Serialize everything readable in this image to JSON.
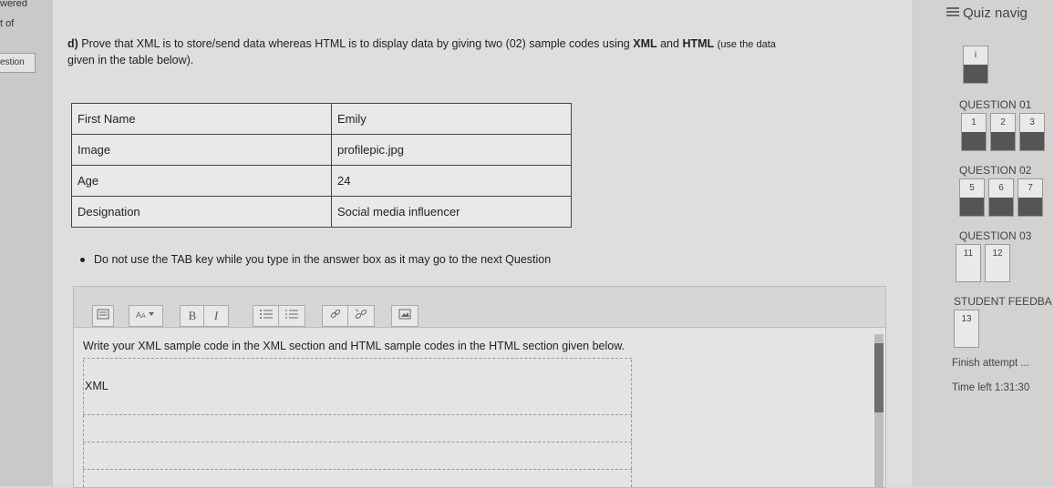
{
  "left_strip": {
    "answered": "wered",
    "of": "t of",
    "question": "estion"
  },
  "question": {
    "part": "d)",
    "text_main": "Prove that XML is to store/send data whereas HTML is to display data by giving two (02) sample codes using",
    "xml": "XML",
    "and": "and",
    "html": "HTML",
    "paren": "(use the data",
    "line2": "given in the table below)."
  },
  "table": [
    {
      "label": "First Name",
      "value": "Emily"
    },
    {
      "label": "Image",
      "value": "profilepic.jpg"
    },
    {
      "label": "Age",
      "value": "24"
    },
    {
      "label": "Designation",
      "value": "Social media influencer"
    }
  ],
  "note": "Do not use the TAB key while you type in the answer box as it may go to the next Question",
  "editor": {
    "toolbar": {
      "bold": "B",
      "italic": "I"
    },
    "instruction": "Write your XML sample code in the XML section and HTML sample codes in the HTML section given below.",
    "xml_label": "XML"
  },
  "nav": {
    "title": "Quiz navig",
    "q_top": "i",
    "sections": [
      {
        "title": "QUESTION 01",
        "buttons": [
          "1",
          "2",
          "3"
        ]
      },
      {
        "title": "QUESTION 02",
        "buttons": [
          "5",
          "6",
          "7"
        ]
      },
      {
        "title": "QUESTION 03",
        "buttons": [
          "11",
          "12"
        ]
      },
      {
        "title": "STUDENT FEEDBA",
        "buttons": [
          "13"
        ]
      }
    ],
    "finish": "Finish attempt ...",
    "time_left": "Time left 1:31:30"
  }
}
